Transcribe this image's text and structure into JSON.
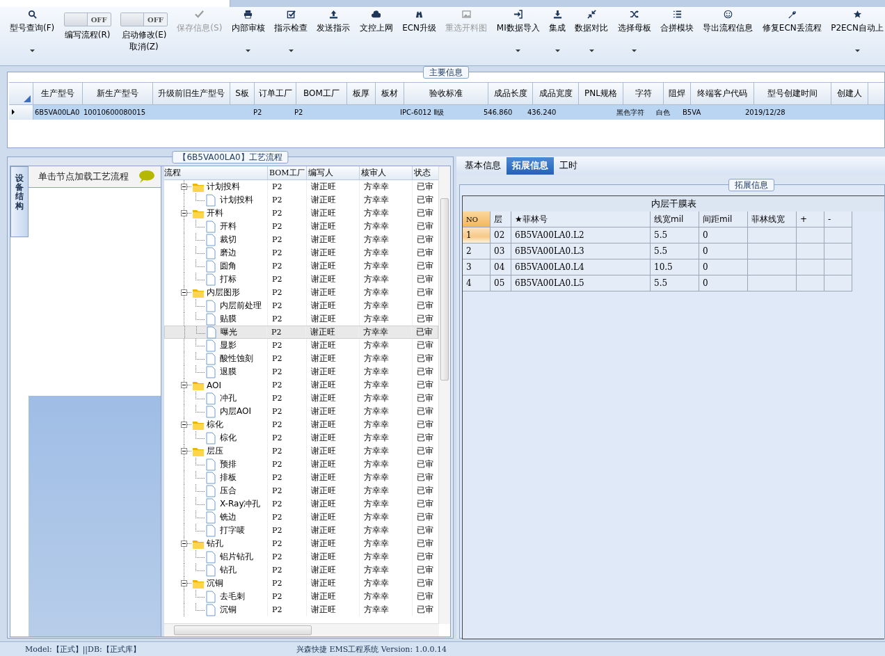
{
  "toolbar": [
    {
      "kind": "button",
      "label": "型号查询(F)",
      "dropdown": true,
      "disabled": false
    },
    {
      "kind": "toggle",
      "label": "编写流程(R)",
      "state": "OFF",
      "on": false
    },
    {
      "kind": "toggle",
      "label": "启动修改(E)",
      "label2": "取消(Z)",
      "state": "OFF",
      "on": false
    },
    {
      "kind": "button",
      "label": "保存信息(S)",
      "dropdown": false,
      "disabled": true
    },
    {
      "kind": "button",
      "label": "内部审核",
      "dropdown": true,
      "disabled": false
    },
    {
      "kind": "button",
      "label": "指示检查",
      "dropdown": true,
      "disabled": false
    },
    {
      "kind": "button",
      "label": "发送指示",
      "dropdown": false,
      "disabled": false
    },
    {
      "kind": "button",
      "label": "文控上网",
      "dropdown": false,
      "disabled": false
    },
    {
      "kind": "button",
      "label": "ECN升级",
      "dropdown": false,
      "disabled": false
    },
    {
      "kind": "button",
      "label": "重选开料图",
      "dropdown": false,
      "disabled": true
    },
    {
      "kind": "button",
      "label": "MI数据导入",
      "dropdown": true,
      "disabled": false
    },
    {
      "kind": "button",
      "label": "集成",
      "dropdown": true,
      "disabled": false
    },
    {
      "kind": "button",
      "label": "数据对比",
      "dropdown": true,
      "disabled": false
    },
    {
      "kind": "button",
      "label": "选择母板",
      "dropdown": true,
      "disabled": false
    },
    {
      "kind": "button",
      "label": "合拼模块",
      "dropdown": false,
      "disabled": false
    },
    {
      "kind": "button",
      "label": "导出流程信息",
      "dropdown": false,
      "disabled": false
    },
    {
      "kind": "button",
      "label": "修复ECN丢流程",
      "dropdown": false,
      "disabled": false
    },
    {
      "kind": "button",
      "label": "P2ECN自动上",
      "dropdown": true,
      "disabled": false
    }
  ],
  "main_info": {
    "title": "主要信息",
    "columns": [
      "生产型号",
      "新生产型号",
      "升级前旧生产型号",
      "S板",
      "订单工厂",
      "BOM工厂",
      "板厚",
      "板材",
      "验收标准",
      "成品长度",
      "成品宽度",
      "PNL规格",
      "字符",
      "阻焊",
      "终端客户代码",
      "型号创建时间",
      "创建人"
    ],
    "rows": [
      {
        "selected": true,
        "cells": [
          "6B5VA00LA0",
          "10010600080015",
          null,
          null,
          "P2",
          "P2",
          null,
          null,
          "IPC-6012 Ⅱ级",
          "546.860",
          "436.240",
          null,
          "黑色字符",
          "白色",
          "B5VA",
          "2019/12/28",
          null
        ]
      }
    ]
  },
  "process": {
    "title": "【6B5VA00LA0】工艺流程",
    "side_tab": "设备结构",
    "hint": "单击节点加载工艺流程",
    "columns": [
      "流程",
      "BOM工厂",
      "编写人",
      "核审人",
      "状态"
    ],
    "tree": [
      {
        "name": "计划投料",
        "bom": "P2",
        "writer": "谢正旺",
        "reviewer": "方幸幸",
        "status": "已审",
        "selected": false,
        "expanded": true,
        "children": [
          {
            "name": "计划投料",
            "bom": "P2",
            "writer": "谢正旺",
            "reviewer": "方幸幸",
            "status": "已审",
            "selected": false
          }
        ]
      },
      {
        "name": "开料",
        "bom": "P2",
        "writer": "谢正旺",
        "reviewer": "方幸幸",
        "status": "已审",
        "selected": false,
        "expanded": true,
        "children": [
          {
            "name": "开料",
            "bom": "P2",
            "writer": "谢正旺",
            "reviewer": "方幸幸",
            "status": "已审",
            "selected": false
          },
          {
            "name": "裁切",
            "bom": "P2",
            "writer": "谢正旺",
            "reviewer": "方幸幸",
            "status": "已审",
            "selected": false
          },
          {
            "name": "磨边",
            "bom": "P2",
            "writer": "谢正旺",
            "reviewer": "方幸幸",
            "status": "已审",
            "selected": false
          },
          {
            "name": "圆角",
            "bom": "P2",
            "writer": "谢正旺",
            "reviewer": "方幸幸",
            "status": "已审",
            "selected": false
          },
          {
            "name": "打标",
            "bom": "P2",
            "writer": "谢正旺",
            "reviewer": "方幸幸",
            "status": "已审",
            "selected": false
          }
        ]
      },
      {
        "name": "内层图形",
        "bom": "P2",
        "writer": "谢正旺",
        "reviewer": "方幸幸",
        "status": "已审",
        "selected": false,
        "expanded": true,
        "children": [
          {
            "name": "内层前处理",
            "bom": "P2",
            "writer": "谢正旺",
            "reviewer": "方幸幸",
            "status": "已审",
            "selected": false
          },
          {
            "name": "贴膜",
            "bom": "P2",
            "writer": "谢正旺",
            "reviewer": "方幸幸",
            "status": "已审",
            "selected": false
          },
          {
            "name": "曝光",
            "bom": "P2",
            "writer": "谢正旺",
            "reviewer": "方幸幸",
            "status": "已审",
            "selected": true
          },
          {
            "name": "显影",
            "bom": "P2",
            "writer": "谢正旺",
            "reviewer": "方幸幸",
            "status": "已审",
            "selected": false
          },
          {
            "name": "酸性蚀刻",
            "bom": "P2",
            "writer": "谢正旺",
            "reviewer": "方幸幸",
            "status": "已审",
            "selected": false
          },
          {
            "name": "退膜",
            "bom": "P2",
            "writer": "谢正旺",
            "reviewer": "方幸幸",
            "status": "已审",
            "selected": false
          }
        ]
      },
      {
        "name": "AOI",
        "bom": "P2",
        "writer": "谢正旺",
        "reviewer": "方幸幸",
        "status": "已审",
        "selected": false,
        "expanded": true,
        "children": [
          {
            "name": "冲孔",
            "bom": "P2",
            "writer": "谢正旺",
            "reviewer": "方幸幸",
            "status": "已审",
            "selected": false
          },
          {
            "name": "内层AOI",
            "bom": "P2",
            "writer": "谢正旺",
            "reviewer": "方幸幸",
            "status": "已审",
            "selected": false
          }
        ]
      },
      {
        "name": "棕化",
        "bom": "P2",
        "writer": "谢正旺",
        "reviewer": "方幸幸",
        "status": "已审",
        "selected": false,
        "expanded": true,
        "children": [
          {
            "name": "棕化",
            "bom": "P2",
            "writer": "谢正旺",
            "reviewer": "方幸幸",
            "status": "已审",
            "selected": false
          }
        ]
      },
      {
        "name": "层压",
        "bom": "P2",
        "writer": "谢正旺",
        "reviewer": "方幸幸",
        "status": "已审",
        "selected": false,
        "expanded": true,
        "children": [
          {
            "name": "预排",
            "bom": "P2",
            "writer": "谢正旺",
            "reviewer": "方幸幸",
            "status": "已审",
            "selected": false
          },
          {
            "name": "排板",
            "bom": "P2",
            "writer": "谢正旺",
            "reviewer": "方幸幸",
            "status": "已审",
            "selected": false
          },
          {
            "name": "压合",
            "bom": "P2",
            "writer": "谢正旺",
            "reviewer": "方幸幸",
            "status": "已审",
            "selected": false
          },
          {
            "name": "X-Ray冲孔",
            "bom": "P2",
            "writer": "谢正旺",
            "reviewer": "方幸幸",
            "status": "已审",
            "selected": false
          },
          {
            "name": "铣边",
            "bom": "P2",
            "writer": "谢正旺",
            "reviewer": "方幸幸",
            "status": "已审",
            "selected": false
          },
          {
            "name": "打字唛",
            "bom": "P2",
            "writer": "谢正旺",
            "reviewer": "方幸幸",
            "status": "已审",
            "selected": false
          }
        ]
      },
      {
        "name": "钻孔",
        "bom": "P2",
        "writer": "谢正旺",
        "reviewer": "方幸幸",
        "status": "已审",
        "selected": false,
        "expanded": true,
        "children": [
          {
            "name": "铝片钻孔",
            "bom": "P2",
            "writer": "谢正旺",
            "reviewer": "方幸幸",
            "status": "已审",
            "selected": false
          },
          {
            "name": "钻孔",
            "bom": "P2",
            "writer": "谢正旺",
            "reviewer": "方幸幸",
            "status": "已审",
            "selected": false
          }
        ]
      },
      {
        "name": "沉铜",
        "bom": "P2",
        "writer": "谢正旺",
        "reviewer": "方幸幸",
        "status": "已审",
        "selected": false,
        "expanded": true,
        "children": [
          {
            "name": "去毛刺",
            "bom": "P2",
            "writer": "谢正旺",
            "reviewer": "方幸幸",
            "status": "已审",
            "selected": false
          },
          {
            "name": "沉铜",
            "bom": "P2",
            "writer": "谢正旺",
            "reviewer": "方幸幸",
            "status": "已审",
            "selected": false
          }
        ]
      }
    ]
  },
  "detail": {
    "tabs": [
      {
        "label": "基本信息",
        "selected": false
      },
      {
        "label": "拓展信息",
        "selected": true
      },
      {
        "label": "工时",
        "selected": false
      }
    ],
    "group_title": "拓展信息",
    "table_title": "内层干膜表",
    "columns": [
      "NO",
      "层",
      "★菲林号",
      "线宽mil",
      "间距mil",
      "菲林线宽",
      "+",
      "-"
    ],
    "rows": [
      {
        "selected": true,
        "cells": [
          "1",
          "02",
          "6B5VA00LA0.L2",
          "5.5",
          "0"
        ]
      },
      {
        "selected": false,
        "cells": [
          "2",
          "03",
          "6B5VA00LA0.L3",
          "5.5",
          "0"
        ]
      },
      {
        "selected": false,
        "cells": [
          "3",
          "04",
          "6B5VA00LA0.L4",
          "10.5",
          "0"
        ]
      },
      {
        "selected": false,
        "cells": [
          "4",
          "05",
          "6B5VA00LA0.L5",
          "5.5",
          "0"
        ]
      }
    ]
  },
  "status_bar": {
    "left": "Model:【正式】||DB:【正式库】",
    "center": "兴森快捷 EMS工程系统 Version: 1.0.0.14"
  }
}
